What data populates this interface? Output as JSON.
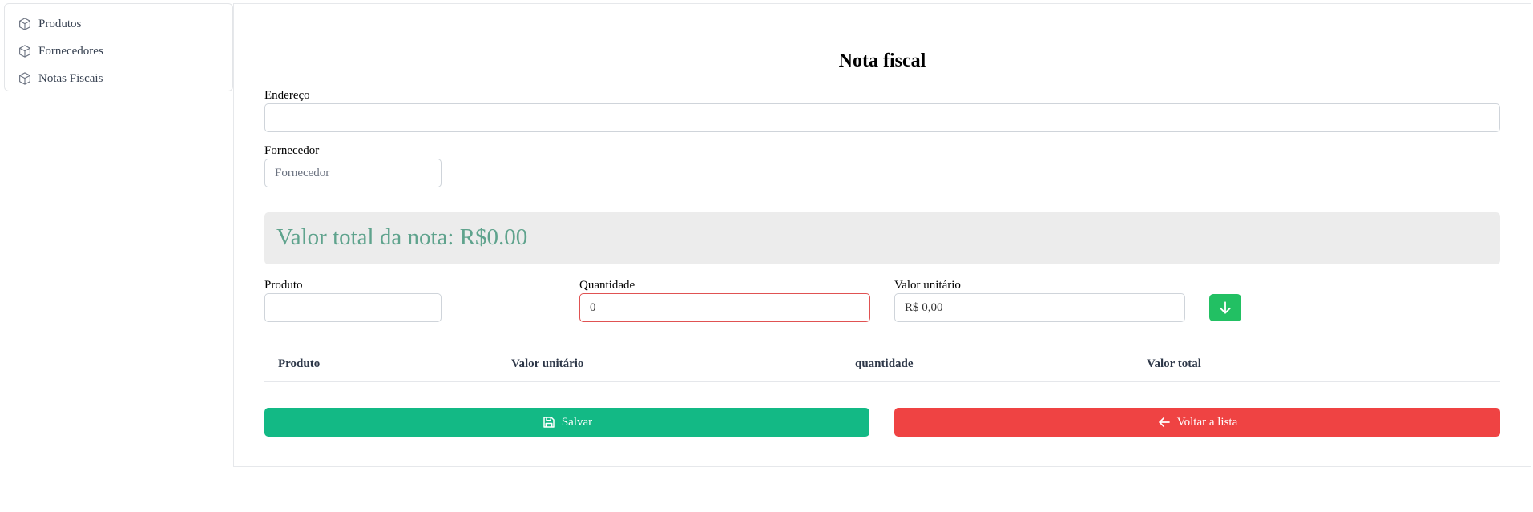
{
  "sidebar": {
    "items": [
      {
        "label": "Produtos",
        "icon": "cube-icon"
      },
      {
        "label": "Fornecedores",
        "icon": "cube-icon"
      },
      {
        "label": "Notas Fiscais",
        "icon": "cube-icon"
      }
    ]
  },
  "form": {
    "title": "Nota fiscal",
    "endereco": {
      "label": "Endereço",
      "value": "",
      "placeholder": ""
    },
    "fornecedor": {
      "label": "Fornecedor",
      "value": "",
      "placeholder": "Fornecedor"
    },
    "total": "Valor total da nota: R$0.00",
    "produto": {
      "label": "Produto",
      "value": ""
    },
    "quantidade": {
      "label": "Quantidade",
      "value": "0"
    },
    "valor_unitario": {
      "label": "Valor unitário",
      "value": "R$ 0,00"
    },
    "add_icon": "arrow-down-icon"
  },
  "table": {
    "headers": [
      "Produto",
      "Valor unitário",
      "quantidade",
      "Valor total"
    ],
    "rows": []
  },
  "actions": {
    "save_label": "Salvar",
    "save_icon": "save-icon",
    "back_label": "Voltar a lista",
    "back_icon": "arrow-left-icon"
  },
  "colors": {
    "save": "#13b985",
    "back": "#ef4343",
    "add": "#22c063",
    "total_text": "#5fa38d",
    "total_bg": "#ececec"
  }
}
